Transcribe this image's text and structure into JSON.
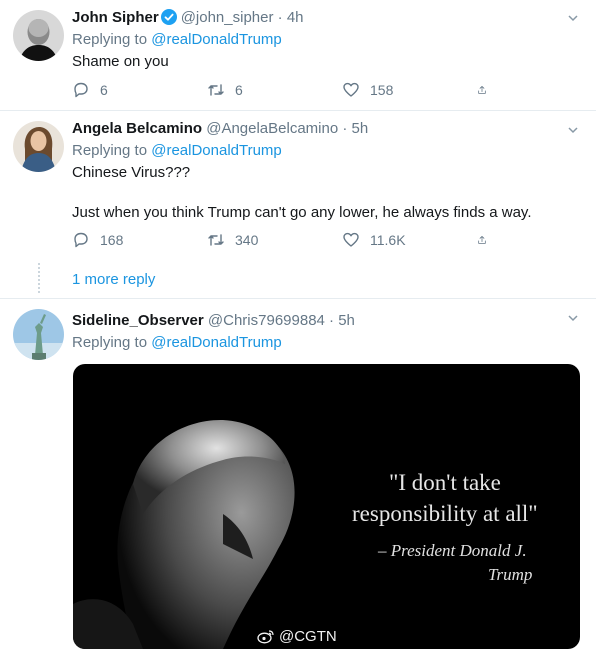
{
  "tweets": [
    {
      "name": "John Sipher",
      "verified": true,
      "handle": "@john_sipher",
      "separator": "·",
      "time": "4h",
      "replying_prefix": "Replying to ",
      "replying_to": "@realDonaldTrump",
      "text": "Shame on you",
      "replies": "6",
      "retweets": "6",
      "likes": "158"
    },
    {
      "name": "Angela Belcamino",
      "handle": "@AngelaBelcamino",
      "separator": "·",
      "time": "5h",
      "replying_prefix": "Replying to ",
      "replying_to": "@realDonaldTrump",
      "text_line1": "Chinese Virus???",
      "text_line2": "Just when you think Trump can't go any lower, he always finds a way.",
      "replies": "168",
      "retweets": "340",
      "likes": "11.6K",
      "more_replies": "1 more reply"
    },
    {
      "name": "Sideline_Observer",
      "handle": "@Chris79699884",
      "separator": "·",
      "time": "5h",
      "replying_prefix": "Replying to ",
      "replying_to": "@realDonaldTrump",
      "media": {
        "quote_line1": "\"I don't take",
        "quote_line2": "responsibility at all\"",
        "attribution_line1": "– President Donald J.",
        "attribution_line2": "Trump",
        "watermark": "@CGTN"
      }
    }
  ],
  "icons": {
    "reply": "reply-icon",
    "retweet": "retweet-icon",
    "like": "heart-icon",
    "share": "share-icon",
    "menu": "chevron-down-icon",
    "verified": "verified-badge-icon"
  },
  "colors": {
    "link": "#1b95e0",
    "secondary_text": "#657786",
    "divider": "#e6ecf0"
  }
}
